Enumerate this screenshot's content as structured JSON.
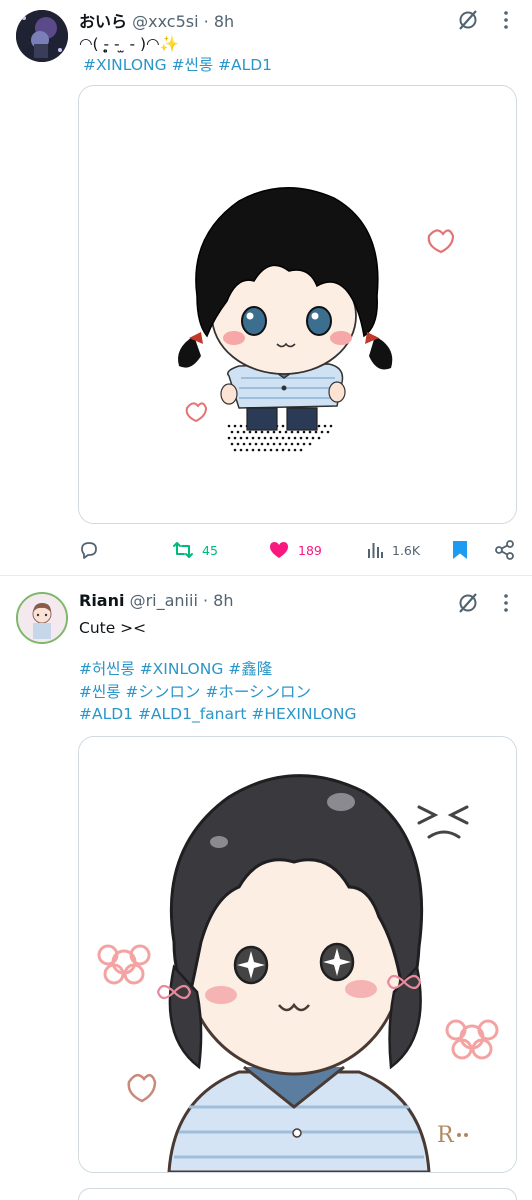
{
  "tweets": [
    {
      "name": "おいら",
      "handle": "@xxc5si",
      "time": "8h",
      "text": "◠( ‐̥̥̥̥̥̥̥̥̥̥̥̥̥̥̥̥̥̥̥̥̥̥ - ̫ - )◠✨",
      "hashtags": "#XINLONG #씬롱  #ALD1",
      "stats": {
        "retweets": "45",
        "likes": "189",
        "views": "1.6K"
      }
    },
    {
      "name": "Riani",
      "handle": "@ri_aniii",
      "time": "8h",
      "text": "Cute ><",
      "hashtag_lines": [
        "#허씬롱 #XINLONG #鑫隆",
        "#씬롱 #シンロン  #ホーシンロン",
        "#ALD1 #ALD1_fanart #HEXINLONG"
      ],
      "signature": "R"
    }
  ],
  "dot": "·",
  "colors": {
    "like": "#f91880",
    "retweet": "#00ba7c",
    "link": "#1d9bf0",
    "bookmark": "#1d9bf0",
    "secondary": "#536471"
  }
}
